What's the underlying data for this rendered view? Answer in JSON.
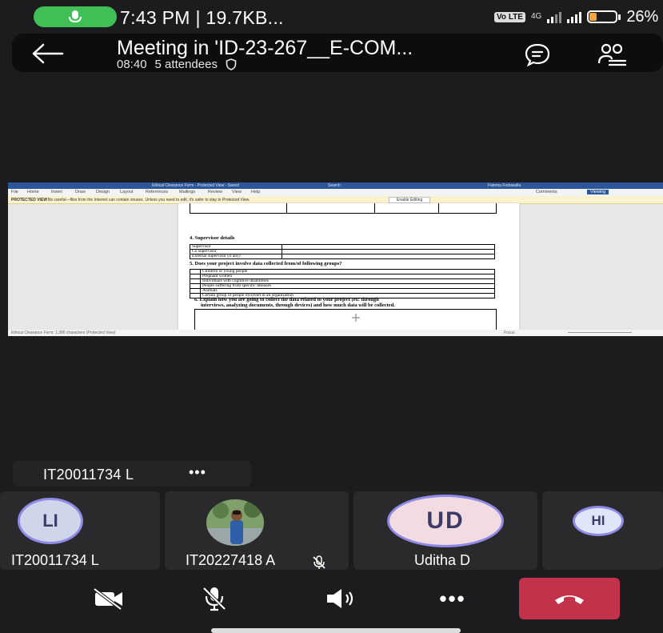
{
  "status_bar": {
    "time_text": "7:43 PM | 19.7KB...",
    "volte_label": "Vo LTE",
    "network_label": "4G",
    "battery_text": "26%",
    "battery_level": 0.26,
    "mic_pill_color": "#3fbf55"
  },
  "meeting": {
    "title": "Meeting in 'ID-23-267__E-COM...",
    "duration": "08:40",
    "attendees": "5 attendees",
    "icons": [
      "back-arrow-icon",
      "shield-icon",
      "chat-icon",
      "people-icon"
    ]
  },
  "shared_screen": {
    "window_title": "Ethical Clearance Form - Protected View - Saved",
    "search_placeholder": "Search",
    "user_name": "Fatema Fodawalla",
    "menu": [
      "File",
      "Home",
      "Insert",
      "Draw",
      "Design",
      "Layout",
      "References",
      "Mailings",
      "Review",
      "View",
      "Help"
    ],
    "comments_label": "Comments",
    "viewing_label": "Viewing",
    "protected_view_label": "PROTECTED VIEW",
    "protected_view_message": "Be careful—files from the Internet can contain viruses. Unless you need to edit, it's safer to stay in Protected View.",
    "enable_editing_label": "Enable Editing",
    "status_text": "Ethical Clearance Form: 1,386 characters  (Protected View)",
    "focus_label": "Focus",
    "document": {
      "section4_heading": "4. Supervisor details",
      "supervisor_rows": [
        "Supervisor",
        "Co supervisor",
        "External supervisor (if any)"
      ],
      "section5_heading": "5. Does your project involve data collected from/of following groups?",
      "groups": [
        "Children or young people",
        "Pregnant women",
        "Individuals with cognitive disabilities",
        "People suffering from specific diseases",
        "Animals",
        "Certain group of people involved in an organization"
      ],
      "section6_line1": "6. Explain how you are going to collect the data related to your project (ex: through",
      "section6_line2": "interviews, analyzing documents, through devices) and how much data will be collected."
    }
  },
  "active_speaker": {
    "name": "IT20011734 L",
    "more_label": "•••"
  },
  "participants": [
    {
      "initials": "LI",
      "name": "IT20011734 L",
      "avatar_color": "#cfd6ea",
      "ring_color": "#8e8ae6"
    },
    {
      "initials": "",
      "name": "IT20227418 A",
      "photo": true,
      "muted": true
    },
    {
      "initials": "UD",
      "name": "Uditha D",
      "avatar_color": "#f3dbe2",
      "ring_color": "#8e8ae6"
    },
    {
      "initials": "HI",
      "name": "",
      "avatar_color": "#dfe6f7",
      "ring_color": "#8e8ae6"
    }
  ],
  "controls": {
    "more_label": "•••",
    "end_call_color": "#c4314b",
    "icons": [
      "camera-off-icon",
      "mic-off-icon",
      "speaker-icon",
      "more-icon",
      "end-call-icon"
    ]
  }
}
